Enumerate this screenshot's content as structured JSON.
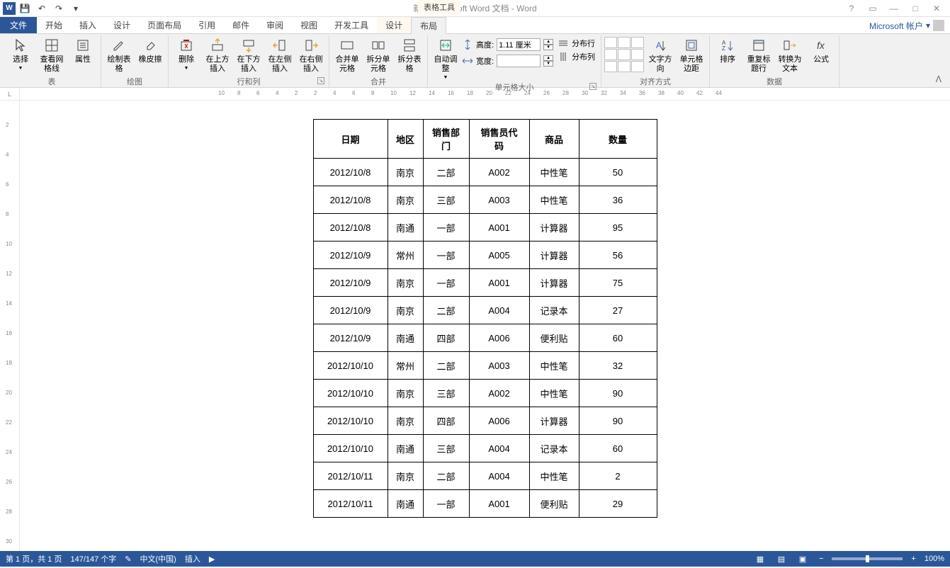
{
  "app": {
    "title": "新建 Microsoft Word 文档 - Word",
    "contextual_label": "表格工具"
  },
  "qat": {
    "save": "保存",
    "undo": "撤销",
    "redo": "重做",
    "customize": "自定义"
  },
  "account": {
    "label": "Microsoft 帐户"
  },
  "tabs": {
    "file": "文件",
    "home": "开始",
    "insert": "插入",
    "design": "设计",
    "pagelayout": "页面布局",
    "references": "引用",
    "mailings": "邮件",
    "review": "审阅",
    "view": "视图",
    "developer": "开发工具",
    "tdesign": "设计",
    "tlayout": "布局"
  },
  "ribbon": {
    "group_table": "表",
    "select": "选择",
    "gridlines": "查看网格线",
    "properties": "属性",
    "group_draw": "绘图",
    "draw_table": "绘制表格",
    "eraser": "橡皮擦",
    "group_rowscols": "行和列",
    "delete": "删除",
    "ins_above": "在上方插入",
    "ins_below": "在下方插入",
    "ins_left": "在左侧插入",
    "ins_right": "在右侧插入",
    "group_merge": "合并",
    "merge": "合并单元格",
    "split": "拆分单元格",
    "split_table": "拆分表格",
    "group_cellsize": "单元格大小",
    "autofit": "自动调整",
    "height_label": "高度:",
    "width_label": "宽度:",
    "height_val": "1.11 厘米",
    "width_val": "",
    "dist_rows": "分布行",
    "dist_cols": "分布列",
    "group_align": "对齐方式",
    "text_dir": "文字方向",
    "margins": "单元格边距",
    "group_data": "数据",
    "sort": "排序",
    "repeat_header": "重复标题行",
    "to_text": "转换为文本",
    "formula": "公式"
  },
  "ruler": {
    "h": [
      "10",
      "8",
      "6",
      "4",
      "2",
      "2",
      "4",
      "6",
      "8",
      "10",
      "12",
      "14",
      "16",
      "18",
      "20",
      "22",
      "24",
      "26",
      "28",
      "30",
      "32",
      "34",
      "36",
      "38",
      "40",
      "42",
      "44"
    ],
    "v": [
      "2",
      "4",
      "6",
      "8",
      "10",
      "12",
      "14",
      "16",
      "18",
      "20",
      "22",
      "24",
      "26",
      "28",
      "30"
    ]
  },
  "table": {
    "headers": [
      "日期",
      "地区",
      "销售部门",
      "销售员代码",
      "商品",
      "数量"
    ],
    "rows": [
      [
        "2012/10/8",
        "南京",
        "二部",
        "A002",
        "中性笔",
        "50"
      ],
      [
        "2012/10/8",
        "南京",
        "三部",
        "A003",
        "中性笔",
        "36"
      ],
      [
        "2012/10/8",
        "南通",
        "一部",
        "A001",
        "计算器",
        "95"
      ],
      [
        "2012/10/9",
        "常州",
        "一部",
        "A005",
        "计算器",
        "56"
      ],
      [
        "2012/10/9",
        "南京",
        "一部",
        "A001",
        "计算器",
        "75"
      ],
      [
        "2012/10/9",
        "南京",
        "二部",
        "A004",
        "记录本",
        "27"
      ],
      [
        "2012/10/9",
        "南通",
        "四部",
        "A006",
        "便利贴",
        "60"
      ],
      [
        "2012/10/10",
        "常州",
        "二部",
        "A003",
        "中性笔",
        "32"
      ],
      [
        "2012/10/10",
        "南京",
        "三部",
        "A002",
        "中性笔",
        "90"
      ],
      [
        "2012/10/10",
        "南京",
        "四部",
        "A006",
        "计算器",
        "90"
      ],
      [
        "2012/10/10",
        "南通",
        "三部",
        "A004",
        "记录本",
        "60"
      ],
      [
        "2012/10/11",
        "南京",
        "二部",
        "A004",
        "中性笔",
        "2"
      ],
      [
        "2012/10/11",
        "南通",
        "一部",
        "A001",
        "便利贴",
        "29"
      ]
    ]
  },
  "status": {
    "page": "第 1 页，共 1 页",
    "words": "147/147 个字",
    "lang": "中文(中国)",
    "mode": "插入",
    "zoom": "100%"
  }
}
